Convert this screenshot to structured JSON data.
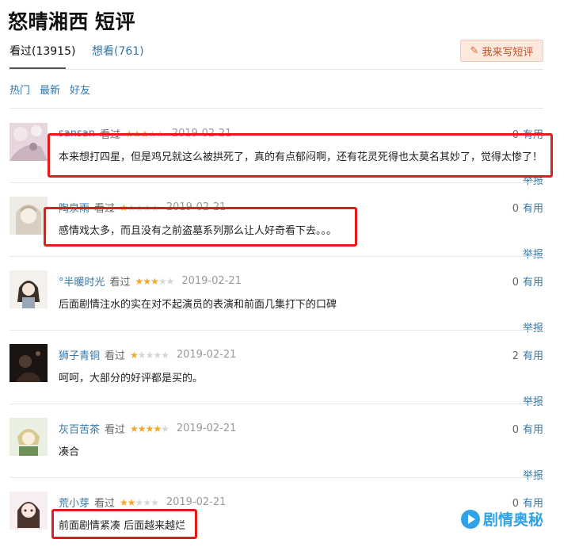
{
  "page": {
    "title_part1": "怒晴湘西",
    "title_part2": "短评"
  },
  "tabs": [
    {
      "label": "看过(13915)",
      "active": true
    },
    {
      "label": "想看(761)",
      "active": false
    }
  ],
  "write_button": {
    "label": "我来写短评",
    "icon": "pencil-icon"
  },
  "sort_links": [
    "热门",
    "最新",
    "好友"
  ],
  "watched_label": "看过",
  "useful_label": "有用",
  "report_label": "举报",
  "star_colors": {
    "on": "#f5a623",
    "off": "#d6d6d6"
  },
  "highlight_color": "#e31b1b",
  "comments": [
    {
      "user": "sansan",
      "rating": 3,
      "date": "2019-02-21",
      "useful_count": "0",
      "text": "本来想打四星，但是鸡兄就这么被拱死了，真的有点郁闷啊，还有花灵死得也太莫名其妙了，觉得太惨了！",
      "highlighted": true
    },
    {
      "user": "陶泉雨",
      "rating": 1,
      "date": "2019-02-21",
      "useful_count": "0",
      "text": "感情戏太多，而且没有之前盗墓系列那么让人好奇看下去。。。",
      "highlighted": true
    },
    {
      "user": "°半暖时光",
      "rating": 3,
      "date": "2019-02-21",
      "useful_count": "0",
      "text": "后面剧情注水的实在对不起演员的表演和前面几集打下的口碑",
      "highlighted": false
    },
    {
      "user": "狮子青铜",
      "rating": 1,
      "date": "2019-02-21",
      "useful_count": "2",
      "text": "呵呵，大部分的好评都是买的。",
      "highlighted": false
    },
    {
      "user": "灰百苦茶",
      "rating": 4,
      "date": "2019-02-21",
      "useful_count": "0",
      "text": "凑合",
      "highlighted": false
    },
    {
      "user": "荒小芽",
      "rating": 2,
      "date": "2019-02-21",
      "useful_count": "0",
      "text": "前面剧情紧凑 后面越来越烂",
      "highlighted": true
    }
  ],
  "watermark": {
    "text": "剧情奥秘",
    "icon": "play-logo-icon"
  }
}
